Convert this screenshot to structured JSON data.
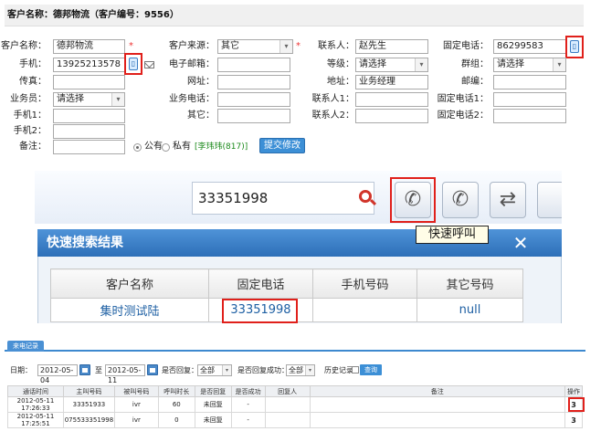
{
  "form": {
    "title": "客户名称：德邦物流（客户编号：9556）",
    "labels": {
      "customer_name": "客户名称：",
      "source": "客户来源：",
      "contact": "联系人：",
      "fixed_phone": "固定电话：",
      "mobile": "手机：",
      "email": "电子邮箱：",
      "level": "等级：",
      "group": "群组：",
      "fax": "传真：",
      "website": "网址：",
      "address": "地址：",
      "zip": "邮编：",
      "salesman": "业务员：",
      "biz_phone": "业务电话：",
      "contact1": "联系人1：",
      "fixed_phone1": "固定电话1：",
      "mobile1": "手机1：",
      "other": "其它：",
      "contact2": "联系人2：",
      "fixed_phone2": "固定电话2：",
      "mobile2": "手机2：",
      "remark": "备注："
    },
    "values": {
      "customer_name": "德邦物流",
      "source": "其它",
      "contact": "赵先生",
      "fixed_phone": "86299583",
      "mobile": "13925213578",
      "level": "请选择",
      "group": "请选择",
      "address": "业务经理",
      "salesman": "请选择"
    },
    "required_mark": "*",
    "phone_icon": "phone-icon",
    "radio_public": "公有",
    "radio_private": "私有",
    "owner_tag": "[李玮玮(817)]",
    "submit_label": "提交修改"
  },
  "dial": {
    "search_value": "33351998",
    "tooltip": "快速呼叫",
    "result_title": "快速搜索结果",
    "close": "✕",
    "columns": [
      "客户名称",
      "固定电话",
      "手机号码",
      "其它号码"
    ],
    "row": [
      "集时测试陆",
      "33351998",
      "",
      "null"
    ]
  },
  "records": {
    "tab_label": "来电记录",
    "date_label": "日期：",
    "date_from": "2012-05-04",
    "to_label": "至",
    "date_to": "2012-05-11",
    "replied_label": "是否回复：",
    "replied_value": "全部",
    "success_label": "是否回复成功：",
    "success_value": "全部",
    "history_label": "历史记录",
    "query_label": "查询",
    "columns": [
      "通话时间",
      "主叫号码",
      "被叫号码",
      "呼叫时长",
      "是否回复",
      "是否成功",
      "回复人",
      "备注",
      "操作"
    ],
    "rows": [
      [
        "2012-05-11 17:26:33",
        "33351933",
        "ivr",
        "60",
        "未回复",
        "-",
        "",
        "",
        "3"
      ],
      [
        "2012-05-11 17:25:51",
        "075533351998",
        "ivr",
        "0",
        "未回复",
        "-",
        "",
        "",
        "3"
      ]
    ]
  }
}
